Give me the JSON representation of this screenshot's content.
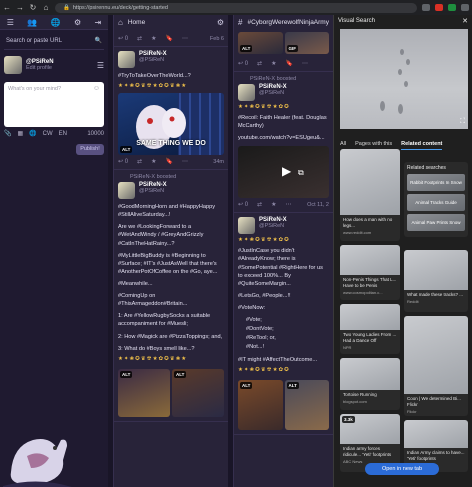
{
  "browser": {
    "url": "https://psirennu.eu/deck/getting-started",
    "back": "←",
    "forward": "→",
    "reload": "↻",
    "home": "⌂"
  },
  "nav": {
    "search_placeholder": "Search or paste URL",
    "profile_name": "@PSiReN",
    "profile_edit": "Edit profile",
    "compose_placeholder": "What's on your mind?",
    "char_count": "10000",
    "publish_label": "Publish!"
  },
  "home": {
    "title": "Home",
    "post_meta_1": "Feb 6",
    "post1": {
      "name": "PSiReN-X",
      "handle": "@PSiReN",
      "text": "#TryToTakeOverTheWorld...?",
      "caption": "SAME THING WE DO",
      "time": "34m"
    },
    "boosted_label": "PSiReN-X boosted",
    "post2": {
      "name": "PSiReN-X",
      "handle": "@PSiReN",
      "p1": "#GoodMorningHorn and #HappyHappy #StillAliveSaturday...!",
      "p2": "Are we #LookingForward to a #WetAndWindy / #GreyAndGrizzly #CatInTheHatRainy...?",
      "p3": "#MyLittleBigBuddy is #Beginning to #Surface; #IT's #JustAsWell that there's #AnotherPotOfCoffee on the #Go, aye...",
      "p4": "#Meanwhile...",
      "p5": "#ComingUp on #ThisArmageddon#Britain...",
      "p6": "1: Are #YellowRugbySocks a suitable accompaniment for #Muesli;",
      "p7": "2: How #Magick are #PizzaToppings; and,",
      "p8": "3: What do #Boys smell like...?"
    }
  },
  "tag": {
    "title": "#CyborgWerewolfNinjaArmy",
    "boosted_label": "PSiReN-X boosted",
    "post1": {
      "name": "PSiReN-X",
      "handle": "@PSiReN",
      "text": "#Recoil: Faith Healer (feat. Douglas McCarthy)",
      "link": "youtube.com/watch?v=ESUgeu&..."
    },
    "post1_time": "Oct 11, 2",
    "post2": {
      "name": "PSiReN-X",
      "handle": "@PSiReN",
      "p1": "#JustInCase you didn't #AlreadyKnow; there is #SomePotential #RightHere for us to exceed 100%... By #QuiteSomeMargin...",
      "p2": "#LetsGo, #People...!!",
      "p3": "#VoteNow:",
      "v1": "#Vote;",
      "v2": "#DontVote;",
      "v3": "#ReTool; or,",
      "v4": "#Not...!",
      "p4": "#IT might #AffectTheOutcome..."
    }
  },
  "visual_search": {
    "title": "Visual Search",
    "tabs": [
      "All",
      "Pages with this",
      "Related content"
    ],
    "active_tab": "Related content",
    "cards": [
      {
        "caption": "How does a man with no legs...",
        "source": "www.reddit.com"
      },
      {
        "caption": "Non-Penis Things That L... Have to be Penis",
        "source": "www.cosmopolitan.c..."
      },
      {
        "caption": "Two Young Ladies From ... Had a Dance Off",
        "source": "NPR"
      },
      {
        "caption": "Tortoise Running",
        "source": "blogspot.com"
      },
      {
        "caption": "Indian army forces ridicule... 'Yeti' footprints",
        "source": "ABC News",
        "badge": "3.3k"
      }
    ],
    "right_cards": [
      {
        "caption": "What made these tracks? ...",
        "source": "Reddit"
      },
      {
        "caption": "Coon | We determined Bi... Flickr",
        "source": "Flickr"
      },
      {
        "caption": "Indian Army claims to have... 'Yeti' footprints",
        "source": "www.swissinfo.ch"
      }
    ],
    "related_searches_title": "Related searches",
    "related_searches": [
      "Rabbit Footprints In Snow",
      "Animal Tracks Guide",
      "Animal Paw Prints Snow"
    ],
    "open_tab_label": "Open in new tab"
  }
}
